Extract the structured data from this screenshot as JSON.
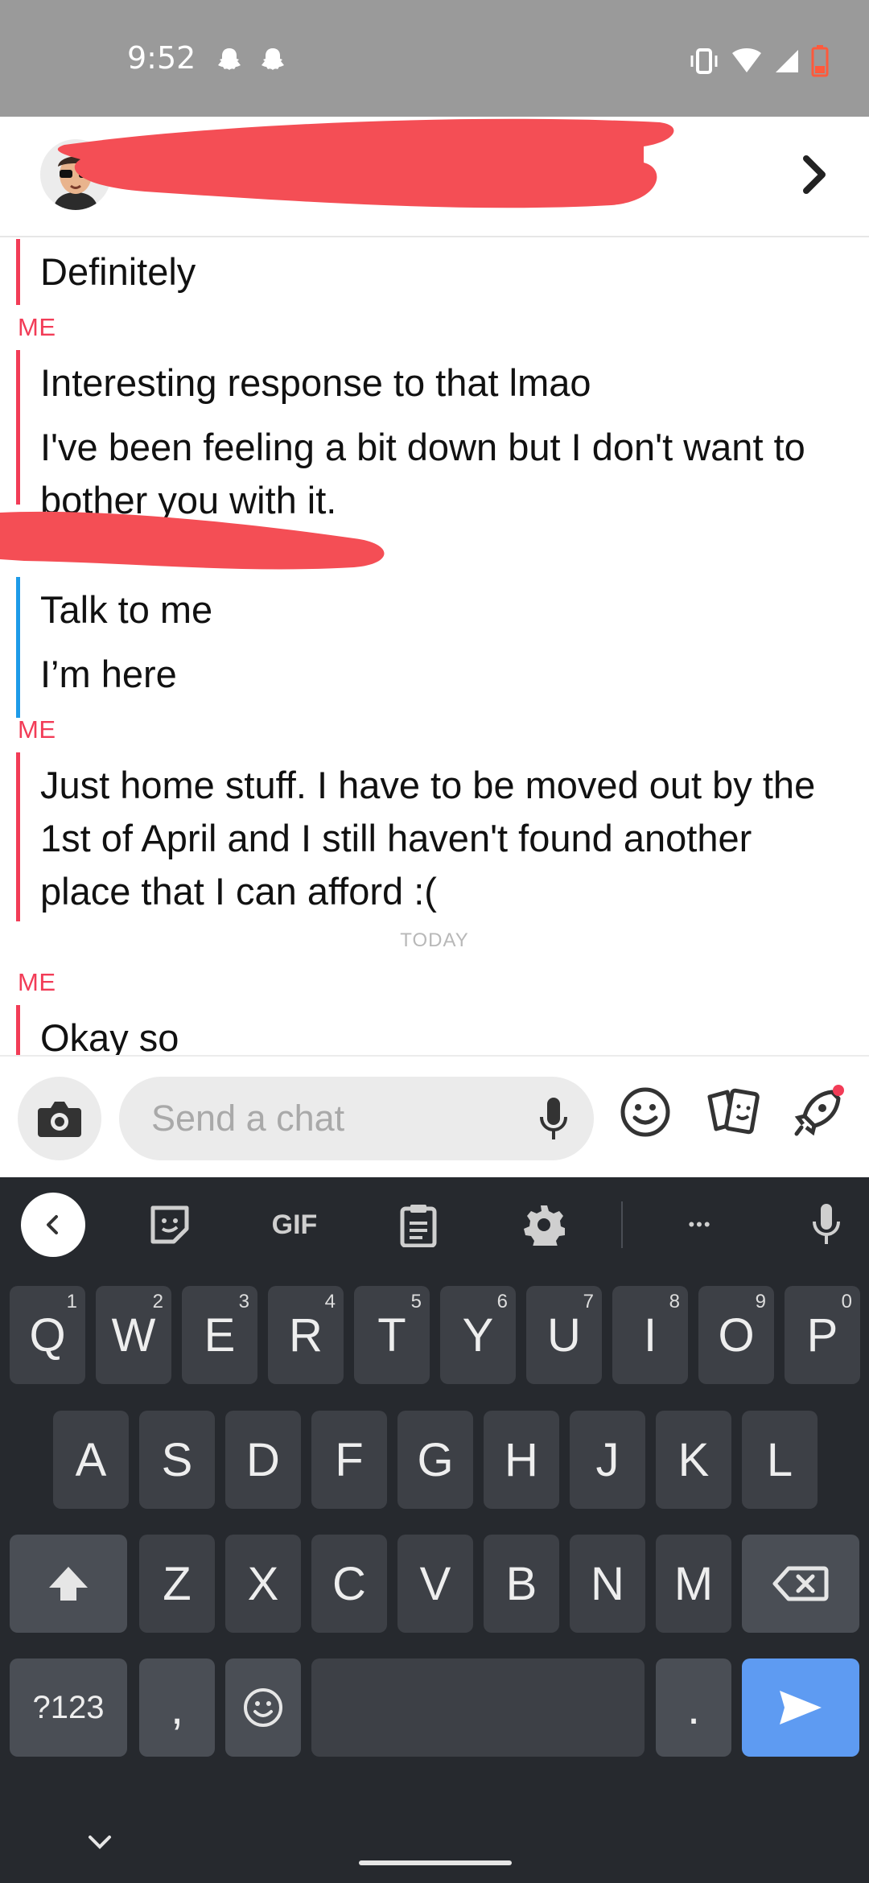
{
  "status_bar": {
    "time": "9:52",
    "icons": [
      "snapchat-ghost-icon",
      "snapchat-ghost-icon",
      "vibrate-icon",
      "wifi-icon",
      "signal-icon",
      "battery-low-icon"
    ]
  },
  "header": {
    "contact_name": "",
    "avatar": "bitmoji-avatar",
    "chevron": "chevron-right-icon"
  },
  "chat": {
    "me_label": "ME",
    "today_label": "TODAY",
    "messages": [
      {
        "text": "Definitely"
      },
      {
        "text": "Interesting response to that lmao"
      },
      {
        "text": "I've been feeling a bit down but I don't want to bother you with it."
      },
      {
        "text": "Talk to me"
      },
      {
        "text": "I’m here"
      },
      {
        "text": "Just home stuff. I have to be moved out by the 1st of April and I still haven't found another place that I can afford :("
      },
      {
        "text": "Okay so"
      }
    ],
    "colors": {
      "me": "#f23c57",
      "them": "#1e9be8"
    }
  },
  "input": {
    "placeholder": "Send a chat",
    "value": ""
  },
  "keyboard": {
    "toolbar": {
      "gif": "GIF",
      "more": "•••"
    },
    "row1": [
      {
        "key": "Q",
        "num": "1"
      },
      {
        "key": "W",
        "num": "2"
      },
      {
        "key": "E",
        "num": "3"
      },
      {
        "key": "R",
        "num": "4"
      },
      {
        "key": "T",
        "num": "5"
      },
      {
        "key": "Y",
        "num": "6"
      },
      {
        "key": "U",
        "num": "7"
      },
      {
        "key": "I",
        "num": "8"
      },
      {
        "key": "O",
        "num": "9"
      },
      {
        "key": "P",
        "num": "0"
      }
    ],
    "row2": [
      "A",
      "S",
      "D",
      "F",
      "G",
      "H",
      "J",
      "K",
      "L"
    ],
    "row3": [
      "Z",
      "X",
      "C",
      "V",
      "B",
      "N",
      "M"
    ],
    "symbols": "?123",
    "comma": ",",
    "period": ".",
    "accent": "#5e9bf2"
  }
}
